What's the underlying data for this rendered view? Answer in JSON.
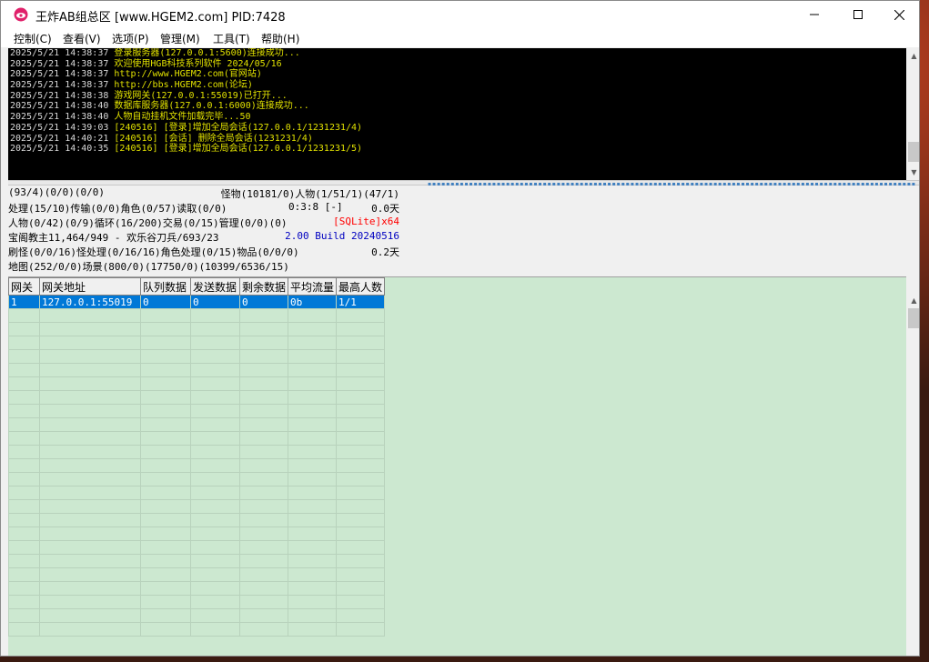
{
  "window": {
    "title": "王炸AB组总区 [www.HGEM2.com] PID:7428",
    "icon": "app-logo-icon"
  },
  "menu": [
    "控制(C)",
    "查看(V)",
    "选项(P)",
    "管理(M)",
    "工具(T)",
    "帮助(H)"
  ],
  "log": [
    {
      "time": "2025/5/21 14:38:37",
      "msg": "登录服务器(127.0.0.1:5600)连接成功..."
    },
    {
      "time": "2025/5/21 14:38:37",
      "msg": "欢迎使用HGB科技系列软件 2024/05/16"
    },
    {
      "time": "2025/5/21 14:38:37",
      "msg": "http://www.HGEM2.com(官网站)"
    },
    {
      "time": "2025/5/21 14:38:37",
      "msg": "http://bbs.HGEM2.com(论坛)"
    },
    {
      "time": "2025/5/21 14:38:38",
      "msg": "游戏网关(127.0.0.1:55019)已打开..."
    },
    {
      "time": "2025/5/21 14:38:40",
      "msg": "数据库服务器(127.0.0.1:6000)连接成功..."
    },
    {
      "time": "2025/5/21 14:38:40",
      "msg": "人物自动挂机文件加载完毕...50"
    },
    {
      "time": "2025/5/21 14:39:03",
      "msg": "[240516] [登录]增加全局会话(127.0.0.1/1231231/4)"
    },
    {
      "time": "2025/5/21 14:40:21",
      "msg": "[240516] [会话] 删除全局会话(1231231/4)"
    },
    {
      "time": "2025/5/21 14:40:35",
      "msg": "[240516] [登录]增加全局会话(127.0.0.1/1231231/5)"
    }
  ],
  "stats": {
    "row1_left": "(93/4)(0/0)(0/0)",
    "row1_right": "怪物(10181/0)人物(1/51/1)(47/1)",
    "row2_left": "处理(15/10)传输(0/0)角色(0/57)读取(0/0)",
    "row2_mid": "0:3:8 [-]",
    "row2_right": "0.0天",
    "row3_left": "人物(0/42)(0/9)循环(16/200)交易(0/15)管理(0/0)(0)",
    "row3_right": "[SQLite]x64",
    "row4_left": "宝阁教主11,464/949 - 欢乐谷刀兵/693/23",
    "row4_right": "2.00 Build 20240516",
    "row5_left": "刷怪(0/0/16)怪处理(0/16/16)角色处理(0/15)物品(0/0/0)",
    "row5_right": "0.2天",
    "row6_left": "地图(252/0/0)场景(800/0)(17750/0)(10399/6536/15)"
  },
  "grid": {
    "columns": [
      "网关",
      "网关地址",
      "队列数据",
      "发送数据",
      "剩余数据",
      "平均流量",
      "最高人数"
    ],
    "rows": [
      [
        "1",
        "127.0.0.1:55019",
        "0",
        "0",
        "0",
        "0b",
        "1/1"
      ]
    ]
  },
  "colors": {
    "log_bg": "#000000",
    "log_text": "#e0e000",
    "selection": "#0078d7",
    "grid_bg": "#cce8d0",
    "sqlite_red": "#ff0000",
    "build_blue": "#0000c0"
  }
}
